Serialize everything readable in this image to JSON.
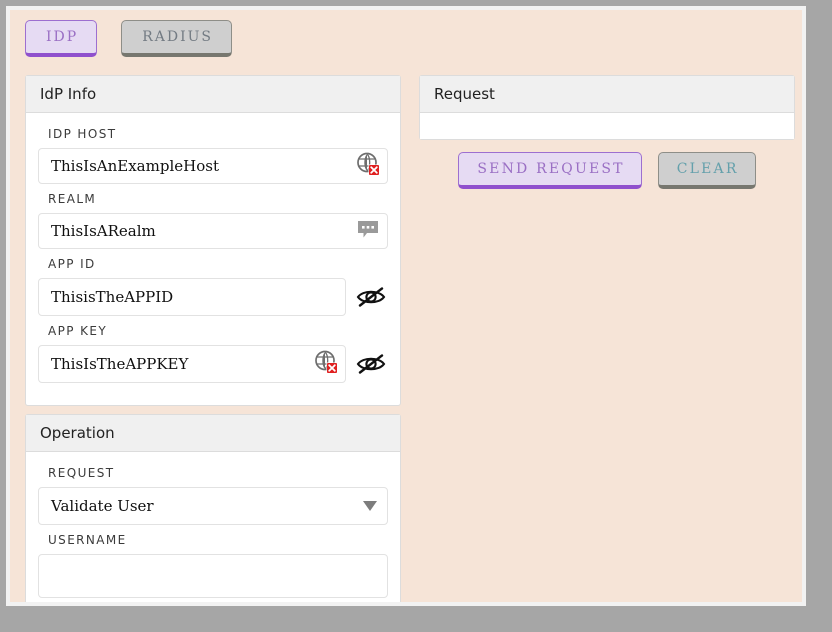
{
  "window": {
    "background_color": "#f6e4d7",
    "frame_color": "#a6a6a6"
  },
  "tabs": [
    {
      "id": "idp",
      "label": "IDP",
      "selected": true,
      "accent": "#9050cd"
    },
    {
      "id": "radius",
      "label": "RADIUS",
      "selected": false,
      "accent": "#77776f"
    }
  ],
  "idp_info": {
    "title": "IdP Info",
    "fields": [
      {
        "label": "IDP HOST",
        "value": "ThisIsAnExampleHost",
        "inline_icon": "broken-image-icon",
        "trailing_icon": null
      },
      {
        "label": "REALM",
        "value": "ThisIsARealm",
        "inline_icon": "tooltip-dots-icon",
        "trailing_icon": null
      },
      {
        "label": "APP ID",
        "value": "ThisisTheAPPID",
        "inline_icon": null,
        "trailing_icon": "eye-slash-icon"
      },
      {
        "label": "APP KEY",
        "value": "ThisIsTheAPPKEY",
        "inline_icon": "broken-image-icon",
        "trailing_icon": "eye-slash-icon"
      }
    ]
  },
  "operation": {
    "title": "Operation",
    "request_label": "REQUEST",
    "request_value": "Validate User",
    "request_options": [
      "Validate User"
    ],
    "username_label": "USERNAME",
    "username_value": "",
    "username_placeholder": ""
  },
  "request_panel": {
    "title": "Request",
    "output_value": "",
    "send_label": "SEND REQUEST",
    "clear_label": "CLEAR",
    "send_color": "#9a6fc4",
    "clear_color": "#64a0ab"
  }
}
